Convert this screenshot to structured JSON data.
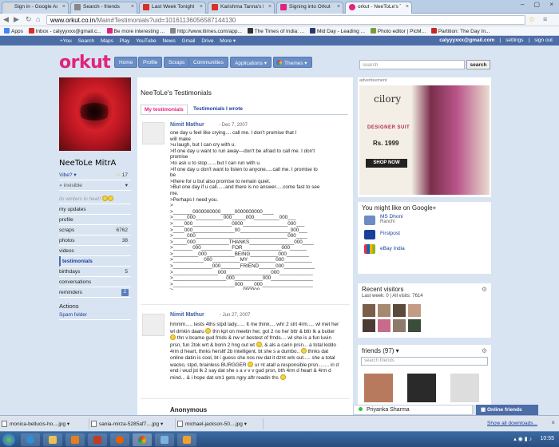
{
  "browser": {
    "tabs": [
      {
        "label": "Sign in - Google Accoun",
        "color": "#d9d9d9"
      },
      {
        "label": "Search - friends",
        "color": "#888888"
      },
      {
        "label": "Last Week Tonight with",
        "color": "#d93025"
      },
      {
        "label": "Karishma Tanna's hot ph",
        "color": "#d93025"
      },
      {
        "label": "Signing into Orkut - Goo",
        "color": "#e0247d"
      },
      {
        "label": "orkut - NeeToLe's Testimo",
        "color": "#e0247d"
      }
    ],
    "url_domain": "www.orkut.co.in",
    "url_path": "/Main#Testimonials?uid=10161136056587144130",
    "bookmarks": [
      {
        "label": "Apps",
        "color": "#4285f4"
      },
      {
        "label": "Inbox - calyyyxxx@gmail.c...",
        "color": "#d93025"
      },
      {
        "label": "Be more interesting ...",
        "color": "#e0247d"
      },
      {
        "label": "http://www.itimes.com/app...",
        "color": "#888888"
      },
      {
        "label": "The Times of India: ...",
        "color": "#333333"
      },
      {
        "label": "Mid Day - Leading ...",
        "color": "#2b3a6b"
      },
      {
        "label": "Photo editor | PicM...",
        "color": "#7b9c3a"
      },
      {
        "label": "Partition: The Day In...",
        "color": "#c62828"
      }
    ]
  },
  "orkut_topbar": {
    "links": [
      "+You",
      "Search",
      "Maps",
      "Play",
      "YouTube",
      "News",
      "Gmail",
      "Drive",
      "More ▾"
    ],
    "email": "calyyyxxx@gmail.com",
    "right_links": [
      "settings",
      "sign out"
    ]
  },
  "header": {
    "logo": "orkut",
    "nav": [
      "Home",
      "Profile",
      "Scraps",
      "Communities",
      "Applications ▾",
      "Themes ▾"
    ],
    "search_placeholder": "search",
    "search_button": "search"
  },
  "left": {
    "name": "NeeToLe MitrA",
    "vibe_label": "Vibe? ▾",
    "vibe_count": "17",
    "status": "invisible",
    "mood_text": "its winters in hea!!",
    "menu": [
      {
        "label": "my updates",
        "count": ""
      },
      {
        "label": "profile",
        "count": ""
      },
      {
        "label": "scraps",
        "count": "6762"
      },
      {
        "label": "photos",
        "count": "38"
      },
      {
        "label": "videos",
        "count": ""
      },
      {
        "label": "testimonials",
        "count": ""
      },
      {
        "label": "birthdays",
        "count": "5"
      },
      {
        "label": "conversations",
        "count": ""
      },
      {
        "label": "reminders",
        "count": "2"
      }
    ],
    "actions_title": "Actions",
    "actions": [
      "Spam folder"
    ]
  },
  "main": {
    "title": "NeeToLe's Testimonials",
    "tab_mine": "My testimonials",
    "tab_wrote": "Testimonials I wrote",
    "t1_name": "Nimit Mathur",
    "t1_date": "- Dec 7, 2007",
    "t1_body": "one day u feel like crying.... call me. I don't promise that I\nwill make\n>u laugh, but I can cry with u.\n>If one day u want to run away---don't be afraid to call me. I don't\npromise\n>to ask u to stop.......but I can run with u.\n>If one day u don't want to listen to anyone.....call me. I promise to\nbe\n>there for u but also promise to remain quiet.\n>But one day if u call......and there is no answer.....come fast to see\nme.\n>Perhaps I need you.\n>\n>_______0000000000_____0000000000____\n>_____000__________000_____000_________000___\n>____000______________0000________________000___\n>____000_______________00__________________000___\n>_____000_________________________________000____\n>_____000____________THANKS________________000____\n>_______000___________FOR______________000______\n>_________000__________BEING__________000________\n>___________000__________MY__________000__________\n>______________000_______FRIEND______000___________\n>________________000________________000____________\n>___________________000__________000_______________\n>______________________000____000__________________\n>_________________________000000___________________",
    "t2_name": "Nimit Mathur",
    "t2_date": "- Jun 27, 2007",
    "t2_body_a": "hmmm..... tests 4ths stpd lady...... It me think.... whr 2 strt 4rm..... wl met her wl drnkin daaru",
    "t2_body_b": " thn kpt on meetin her, got 2 no her bttr & bttr lk a butter",
    "t2_body_c": " thn v bcame gud frnds & nw vr bestest of frnds.... wl she is a fun luvin prsn, fun 2tok wrt & borin 2 hng out wt",
    "t2_body_d": ", & als a carin prsn... a total kiddo 4rm d heart, thnks hersltf 2b intelligent, bt she s a dumbo..",
    "t2_body_e": " thnks dat online datin is cool, bt i guess she nos nw dat it dznt wrk out..... she a total wacko, stpd, brainless BURGGER",
    "t2_body_f": " ur nt atall a responsible prsn........ in d end i wud jst lk 2 say dat she s a v v v gud prsn, bth 4rm d heart & 4rm d mind... & i hope dat sm1 gets ngry aftr readin ths",
    "t3_name": "Anonymous"
  },
  "right": {
    "ad_label": "advertisement",
    "ad_brand": "cilory",
    "ad_tagline": "DESIGNER SUIT",
    "ad_price": "Rs. 1999",
    "ad_shop": "SHOP NOW",
    "gplus_title": "You might like on Google+",
    "gplus": [
      {
        "name": "MS Dhoni",
        "sub": "Ranchi",
        "color": "#6b8cc4"
      },
      {
        "name": "Firstpost",
        "sub": "",
        "color": "#1a3f9a"
      },
      {
        "name": "eBay India",
        "sub": "",
        "color": "#e53238"
      }
    ],
    "visitors_title": "Recent visitors",
    "visitors_stats": "Last week: 0 | All visits: 7614",
    "friends_title": "friends (97) ▾",
    "friends_search_placeholder": "search friends"
  },
  "chat": {
    "name": "Priyanka Sharma",
    "online_label": "Online friends"
  },
  "downloads": {
    "items": [
      "monica-bellucis-ho....jpg",
      "sania-mirza-5285af7....jpg",
      "michael-jackson-50....jpg"
    ],
    "show_all": "Show all downloads..."
  },
  "taskbar": {
    "clock": "10:55"
  }
}
